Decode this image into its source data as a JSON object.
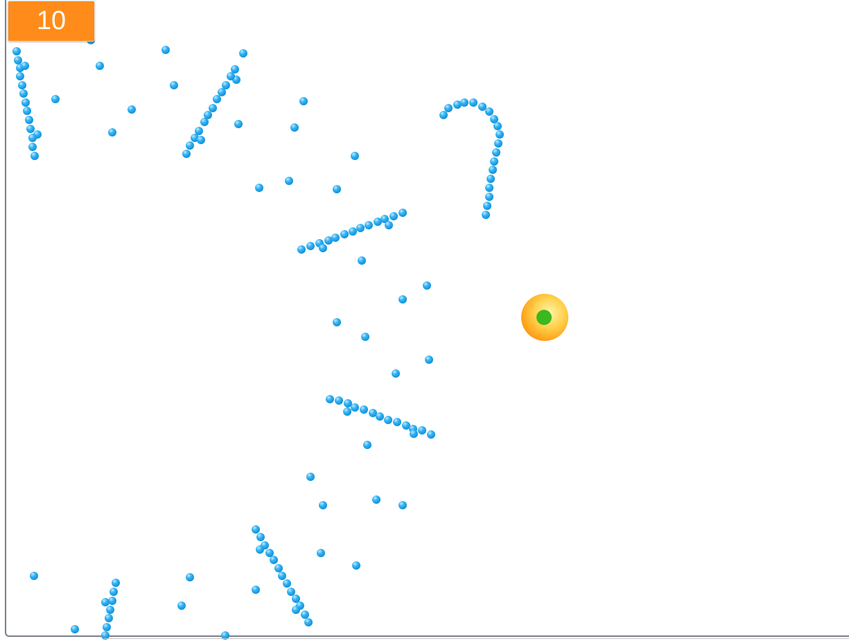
{
  "game": {
    "score": "10",
    "colors": {
      "pellet": "#2aa7ee",
      "pellet_highlight": "#a9e2ff",
      "player_outer": "#ffab20",
      "player_inner": "#fff29a",
      "player_core": "#3cb81e",
      "score_bg": "#ff8c1a",
      "border": "#7a7f8a"
    },
    "player": {
      "icon": "player-orb-icon"
    },
    "pellet_icon": "pellet-icon"
  }
}
